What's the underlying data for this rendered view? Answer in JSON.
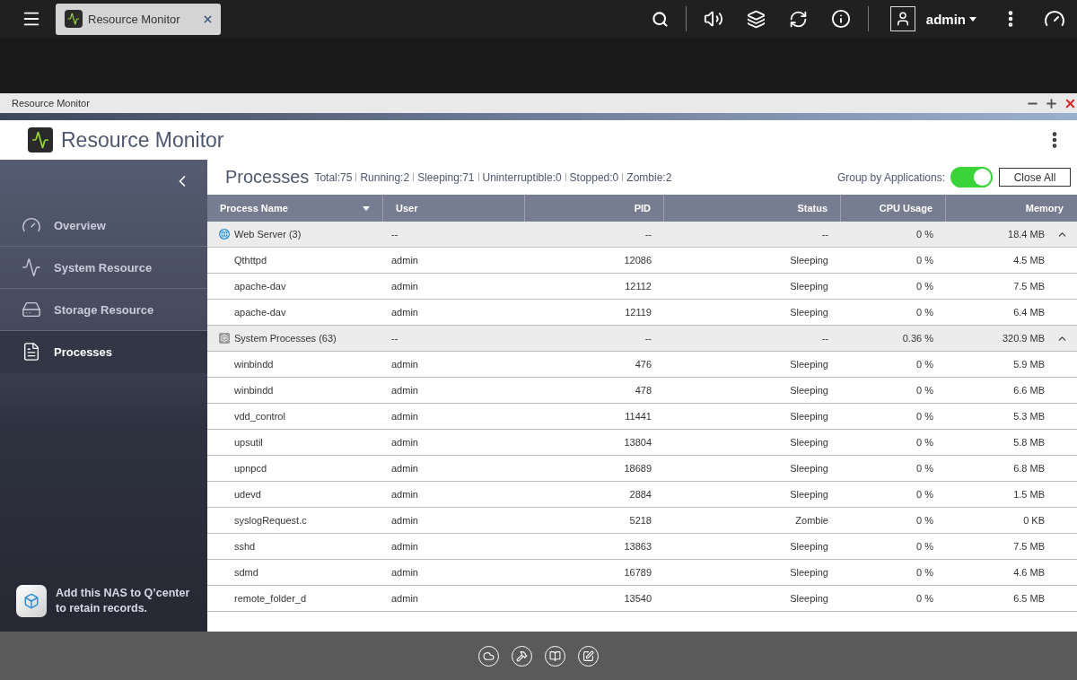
{
  "topbar": {
    "tab": {
      "title": "Resource Monitor"
    },
    "user": "admin"
  },
  "window": {
    "title": "Resource Monitor",
    "app_title": "Resource Monitor"
  },
  "sidebar": {
    "items": [
      {
        "label": "Overview",
        "selected": false
      },
      {
        "label": "System Resource",
        "selected": false
      },
      {
        "label": "Storage Resource",
        "selected": false
      },
      {
        "label": "Processes",
        "selected": true
      }
    ],
    "promo": "Add this NAS to Q’center to retain records."
  },
  "processes": {
    "title": "Processes",
    "stats": [
      "Total:75",
      "Running:2",
      "Sleeping:71",
      "Uninterruptible:0",
      "Stopped:0",
      "Zombie:2"
    ],
    "group_toggle": {
      "label": "Group by Applications:",
      "on": true
    },
    "close_all": "Close All",
    "columns": [
      "Process Name",
      "User",
      "PID",
      "Status",
      "CPU Usage",
      "Memory"
    ],
    "groups": [
      {
        "name": "Web Server (3)",
        "user": "--",
        "pid": "--",
        "status": "--",
        "cpu": "0 %",
        "memory": "18.4 MB",
        "expanded": true,
        "children": [
          {
            "name": "Qthttpd",
            "user": "admin",
            "pid": "12086",
            "status": "Sleeping",
            "cpu": "0 %",
            "memory": "4.5 MB"
          },
          {
            "name": "apache-dav",
            "user": "admin",
            "pid": "12112",
            "status": "Sleeping",
            "cpu": "0 %",
            "memory": "7.5 MB"
          },
          {
            "name": "apache-dav",
            "user": "admin",
            "pid": "12119",
            "status": "Sleeping",
            "cpu": "0 %",
            "memory": "6.4 MB"
          }
        ]
      },
      {
        "name": "System Processes (63)",
        "user": "--",
        "pid": "--",
        "status": "--",
        "cpu": "0.36 %",
        "memory": "320.9 MB",
        "expanded": true,
        "children": [
          {
            "name": "winbindd",
            "user": "admin",
            "pid": "476",
            "status": "Sleeping",
            "cpu": "0 %",
            "memory": "5.9 MB"
          },
          {
            "name": "winbindd",
            "user": "admin",
            "pid": "478",
            "status": "Sleeping",
            "cpu": "0 %",
            "memory": "6.6 MB"
          },
          {
            "name": "vdd_control",
            "user": "admin",
            "pid": "11441",
            "status": "Sleeping",
            "cpu": "0 %",
            "memory": "5.3 MB"
          },
          {
            "name": "upsutil",
            "user": "admin",
            "pid": "13804",
            "status": "Sleeping",
            "cpu": "0 %",
            "memory": "5.8 MB"
          },
          {
            "name": "upnpcd",
            "user": "admin",
            "pid": "18689",
            "status": "Sleeping",
            "cpu": "0 %",
            "memory": "6.8 MB"
          },
          {
            "name": "udevd",
            "user": "admin",
            "pid": "2884",
            "status": "Sleeping",
            "cpu": "0 %",
            "memory": "1.5 MB"
          },
          {
            "name": "syslogRequest.c",
            "user": "admin",
            "pid": "5218",
            "status": "Zombie",
            "cpu": "0 %",
            "memory": "0 KB"
          },
          {
            "name": "sshd",
            "user": "admin",
            "pid": "13863",
            "status": "Sleeping",
            "cpu": "0 %",
            "memory": "7.5 MB"
          },
          {
            "name": "sdmd",
            "user": "admin",
            "pid": "16789",
            "status": "Sleeping",
            "cpu": "0 %",
            "memory": "4.6 MB"
          },
          {
            "name": "remote_folder_d",
            "user": "admin",
            "pid": "13540",
            "status": "Sleeping",
            "cpu": "0 %",
            "memory": "6.5 MB"
          }
        ]
      }
    ]
  }
}
